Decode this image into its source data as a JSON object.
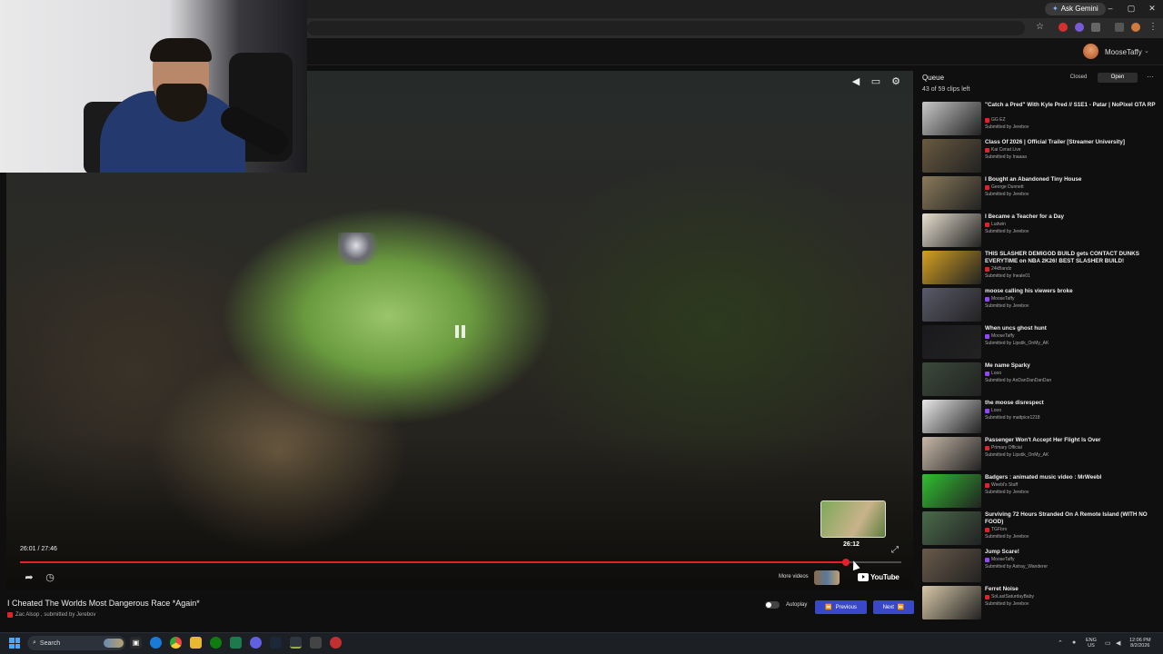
{
  "browser": {
    "ask_label": "Ask Gemini",
    "minimize": "–",
    "maximize": "▢",
    "close": "✕"
  },
  "header": {
    "username": "MooseTaffy"
  },
  "player": {
    "timecode": "26:01 / 27:46",
    "preview_time": "26:12",
    "progress_fraction": 0.937,
    "more_videos_label": "More videos",
    "youtube_label": "YouTube"
  },
  "video": {
    "title": "I Cheated The Worlds Most Dangerous Race *Again*",
    "meta": "Zac Alsop , submitted by Jerebov",
    "autoplay_label": "Autoplay",
    "previous_label": "Previous",
    "next_label": "Next"
  },
  "queue": {
    "title": "Queue",
    "count": "43 of 59 clips left",
    "tab_closed": "Closed",
    "tab_open": "Open",
    "more": "···",
    "items": [
      {
        "title": "\"Catch a Pred\" With Kyle Pred // S1E1 - Patar | NoPixel GTA RP",
        "channel": "GG EZ",
        "submitted": "Submitted by Jerebov",
        "platform": "youtube",
        "thumb": "#c8c8c8"
      },
      {
        "title": "Class Of 2026 | Official Trailer [Streamer University]",
        "channel": "Kai Cenat Live",
        "submitted": "Submitted by Inaaaa",
        "platform": "youtube",
        "thumb": "#6a5a40"
      },
      {
        "title": "I Bought an Abandoned Tiny House",
        "channel": "George Dunnett",
        "submitted": "Submitted by Jerebov",
        "platform": "youtube",
        "thumb": "#8a7a5a"
      },
      {
        "title": "I Became a Teacher for a Day",
        "channel": "Ludwin",
        "submitted": "Submitted by Jerebov",
        "platform": "youtube",
        "thumb": "#e8e0d0"
      },
      {
        "title": "THIS SLASHER DEMIGOD BUILD gets CONTACT DUNKS EVERYTIME on NBA 2K26! BEST SLASHER BUILD!",
        "channel": "24kBandz",
        "submitted": "Submitted by Ineale01",
        "platform": "youtube",
        "thumb": "#d4a020"
      },
      {
        "title": "moose calling his viewers broke",
        "channel": "MooseTaffy",
        "submitted": "Submitted by Jerebov",
        "platform": "twitch",
        "thumb": "#5a5a6a"
      },
      {
        "title": "When uncs ghost hunt",
        "channel": "MooseTaffy",
        "submitted": "Submitted by Lipstik_OnMy_AK",
        "platform": "twitch",
        "thumb": "#1a1a1e"
      },
      {
        "title": "Me name Sparky",
        "channel": "Looo",
        "submitted": "Submitted by AnDanDanDanDan",
        "platform": "twitch",
        "thumb": "#3a4a3a"
      },
      {
        "title": "the moose disrespect",
        "channel": "Looo",
        "submitted": "Submitted by mattpice1218",
        "platform": "twitch",
        "thumb": "#e8e8e8"
      },
      {
        "title": "Passenger Won't Accept Her Flight Is Over",
        "channel": "Primary Official",
        "submitted": "Submitted by Lipstik_OnMy_AK",
        "platform": "youtube",
        "thumb": "#c8b8a8"
      },
      {
        "title": "Badgers : animated music video : MrWeebl",
        "channel": "Weebl's Stuff",
        "submitted": "Submitted by Jerebov",
        "platform": "youtube",
        "thumb": "#30c030"
      },
      {
        "title": "Surviving 72 Hours Stranded On A Remote Island (WITH NO FOOD)",
        "channel": "TGFbro",
        "submitted": "Submitted by Jerebov",
        "platform": "youtube",
        "thumb": "#4a6a4a"
      },
      {
        "title": "Jump Scare!",
        "channel": "MooseTaffy",
        "submitted": "Submitted by Astray_Wanderer",
        "platform": "twitch",
        "thumb": "#6a5a4a"
      },
      {
        "title": "Ferret Noise",
        "channel": "SoLastSaturdayBaby",
        "submitted": "Submitted by Jerebov",
        "platform": "youtube",
        "thumb": "#d8c8a8"
      }
    ]
  },
  "taskbar": {
    "search_label": "Search",
    "lang1": "ENG",
    "lang2": "US",
    "time": "12:06 PM",
    "date": "8/2/2026"
  },
  "colors": {
    "accent": "#3848c8",
    "progress": "#e4202a",
    "youtube": "#e4202a",
    "twitch": "#9146ff"
  }
}
